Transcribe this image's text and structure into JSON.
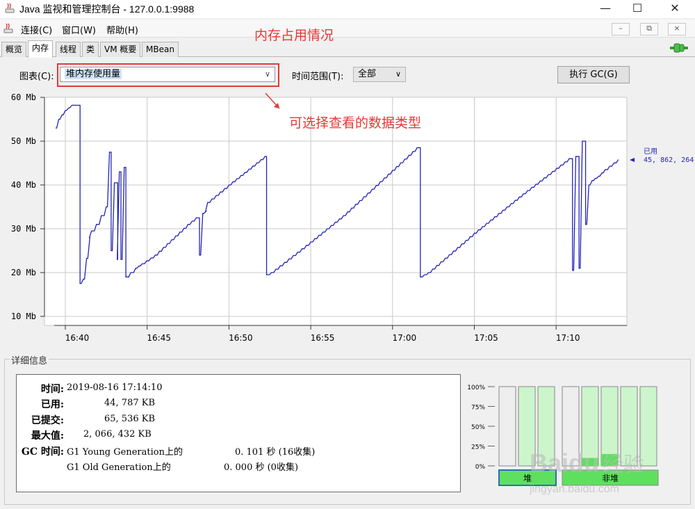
{
  "window": {
    "title": "Java 监视和管理控制台 - 127.0.0.1:9988",
    "minimize": "—",
    "maximize": "☐",
    "close": "✕"
  },
  "menu": {
    "items": [
      "连接(C)",
      "窗口(W)",
      "帮助(H)"
    ],
    "inner_buttons": [
      "–",
      "⧉",
      "×"
    ]
  },
  "annotations": {
    "top": "内存占用情况",
    "chart": "可选择查看的数据类型"
  },
  "tabs": [
    "概览",
    "内存",
    "线程",
    "类",
    "VM 概要",
    "MBean"
  ],
  "active_tab": "内存",
  "toolbar": {
    "chart_label": "图表(C):",
    "chart_value": "堆内存使用量",
    "range_label": "时间范围(T):",
    "range_value": "全部",
    "gc_button": "执行 GC(G)"
  },
  "chart_data": {
    "type": "line",
    "y_ticks": [
      "60 Mb",
      "50 Mb",
      "40 Mb",
      "30 Mb",
      "20 Mb",
      "10 Mb"
    ],
    "ylim": [
      10,
      60
    ],
    "x_ticks": [
      "16:40",
      "16:45",
      "16:50",
      "16:55",
      "17:00",
      "17:05",
      "17:10"
    ],
    "grid": true,
    "color": "#2323b4",
    "legend": {
      "label": "已用",
      "value": "45, 862, 264"
    },
    "series": [
      {
        "x": [
          "16:39.4",
          "16:39.6",
          "16:40.0",
          "16:40.4",
          "16:40.9",
          "16:41.1",
          "16:41.5",
          "16:41.6",
          "16:41.9",
          "16:42.2",
          "16:42.5",
          "16:42.7",
          "16:42.8",
          "16:43.0",
          "16:43.2",
          "16:43.3",
          "16:43.4",
          "16:43.6",
          "16:43.7",
          "16:44.0",
          "16:44.3",
          "16:44.7",
          "16:45.5",
          "16:47.5",
          "16:48.0",
          "16:48.2",
          "16:48.4",
          "16:48.6",
          "16:48.7",
          "16:50.0",
          "16:52.2",
          "16:52.3",
          "16:52.6",
          "16:55.0",
          "16:57.0",
          "17:01.5",
          "17:01.7",
          "17:02.2",
          "17:05.0",
          "17:08.0",
          "17:10.8",
          "17:11.0",
          "17:11.2",
          "17:11.4",
          "17:11.6",
          "17:11.8",
          "17:12.0",
          "17:12.2",
          "17:12.6",
          "17:13.0",
          "17:13.8"
        ],
        "y": [
          53.0,
          55.0,
          57.0,
          58.2,
          17.5,
          18.5,
          28.0,
          29.5,
          31.0,
          33.0,
          35.0,
          47.5,
          25.0,
          40.5,
          23.0,
          43.0,
          23.0,
          44.0,
          19.0,
          20.0,
          21.0,
          22.0,
          24.0,
          31.0,
          32.5,
          24.0,
          33.5,
          34.0,
          36.0,
          40.0,
          46.5,
          19.5,
          20.0,
          27.0,
          33.0,
          48.5,
          19.0,
          20.0,
          29.0,
          38.0,
          46.0,
          20.5,
          46.5,
          21.0,
          50.0,
          31.0,
          40.0,
          41.0,
          42.0,
          43.5,
          45.8
        ]
      }
    ]
  },
  "details": {
    "title": "详细信息",
    "rows": [
      {
        "label": "时间:",
        "value": "2019-08-16 17:14:10"
      },
      {
        "label": "已用:",
        "value": "44, 787 KB"
      },
      {
        "label": "已提交:",
        "value": "65, 536 KB"
      },
      {
        "label": "最大值:",
        "value": "2, 066, 432 KB"
      }
    ],
    "gc_label": "GC 时间:",
    "gc": [
      {
        "name": "G1 Young Generation上的",
        "time": "0. 101  秒 (16收集)"
      },
      {
        "name": "G1 Old Generation上的",
        "time": "0. 000  秒 (0收集)"
      }
    ]
  },
  "pool_bars": {
    "y_ticks": [
      "100%",
      "75%",
      "50%",
      "25%",
      "0%"
    ],
    "groups": [
      "堆",
      "非堆"
    ],
    "pools": [
      {
        "group": "heap",
        "used": 0.0
      },
      {
        "group": "heap",
        "used": 0.0
      },
      {
        "group": "heap",
        "used": 0.0
      },
      {
        "group": "nonheap",
        "used": 0.0
      },
      {
        "group": "nonheap",
        "used": 0.1
      },
      {
        "group": "nonheap",
        "used": 0.15
      },
      {
        "group": "nonheap",
        "used": 0.0
      },
      {
        "group": "nonheap",
        "used": 0.0
      }
    ]
  },
  "watermark": "Baidu经验 jingyan.baidu.com"
}
